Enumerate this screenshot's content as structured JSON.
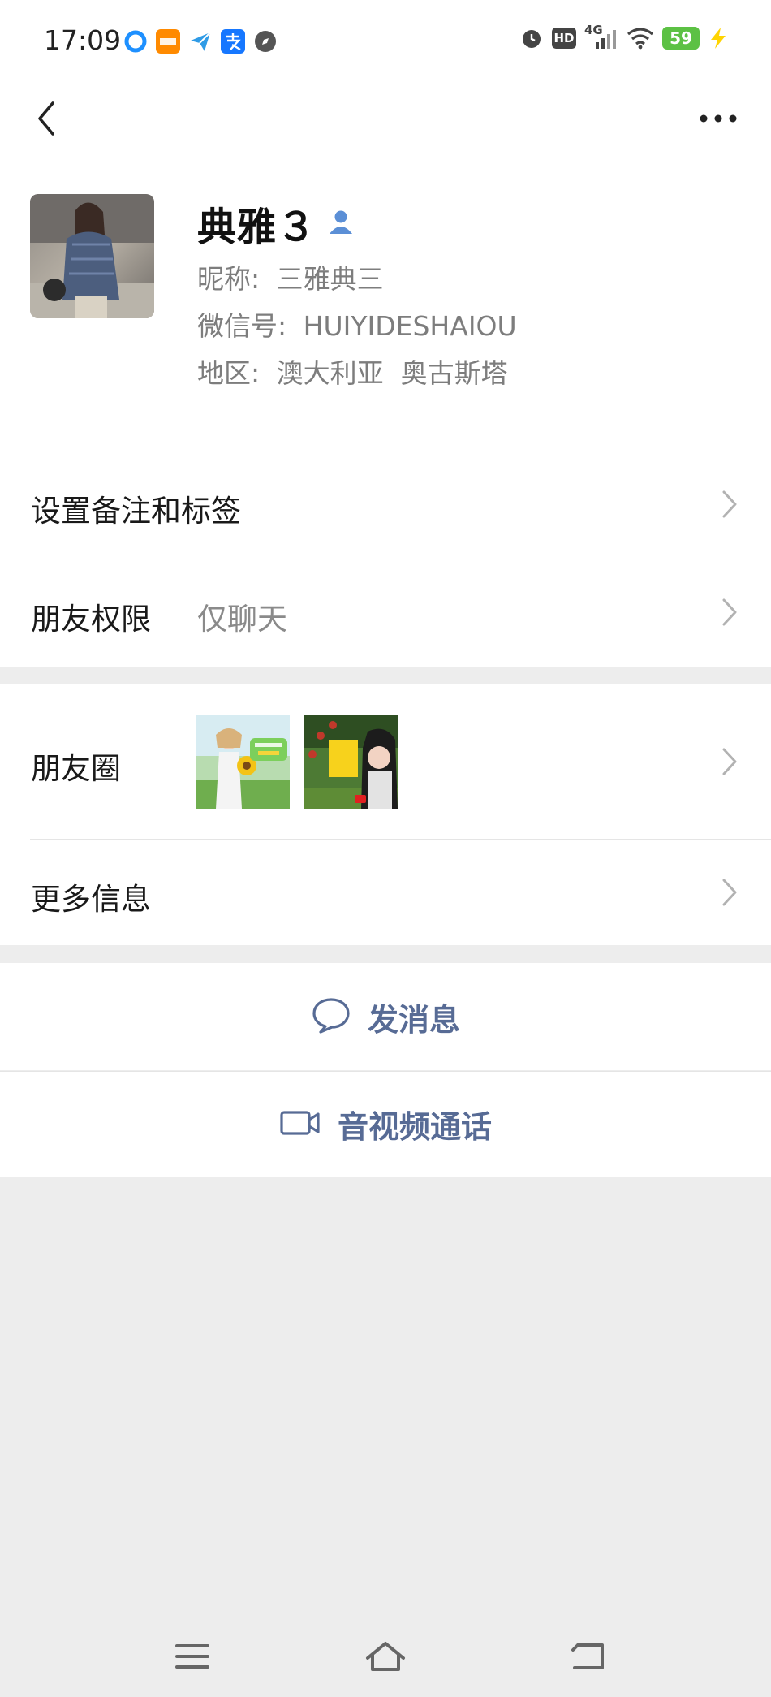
{
  "status_bar": {
    "time": "17:09",
    "network": "4G",
    "hd_badge": "HD",
    "battery": "59",
    "app_icons": [
      "qq-browser-icon",
      "taobao-icon",
      "message-send-icon",
      "alipay-icon",
      "compass-icon"
    ]
  },
  "profile": {
    "display_name": "典雅３",
    "nickname_label": "昵称:",
    "nickname": "三雅典三",
    "wechat_id_label": "微信号:",
    "wechat_id": "HUIYIDESHAIOU",
    "region_label": "地区:",
    "region": "澳大利亚  奥古斯塔"
  },
  "menu": {
    "remarks_tags": "设置备注和标签",
    "permissions_label": "朋友权限",
    "permissions_value": "仅聊天",
    "moments_label": "朋友圈",
    "more_info": "更多信息"
  },
  "actions": {
    "send_message": "发消息",
    "video_call": "音视频通话"
  },
  "colors": {
    "accent": "#576b95",
    "background": "#ededed",
    "battery": "#5cc144"
  }
}
